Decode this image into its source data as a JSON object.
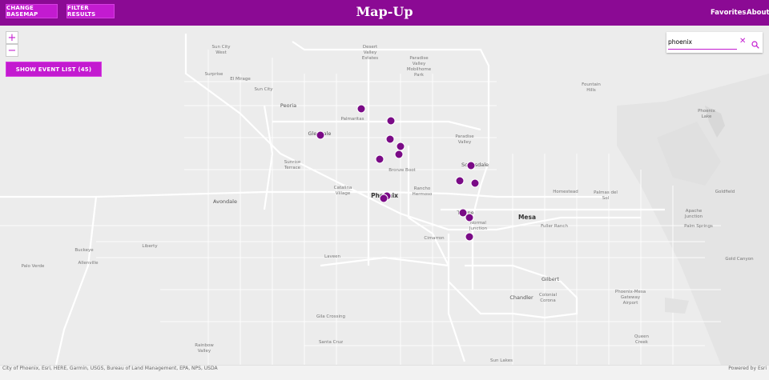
{
  "header": {
    "title": "Map-Up",
    "change_basemap": "CHANGE BASEMAP",
    "filter_results": "FILTER RESULTS",
    "favorites": "Favorites",
    "about": "About"
  },
  "map": {
    "show_event_list": "SHOW EVENT LIST (45)",
    "search_value": "phoenix",
    "zoom_in": "+",
    "zoom_out": "−",
    "labels": {
      "sun_city_west": "Sun City\nWest",
      "desert_valley": "Desert\nValley\nEstates",
      "paradise_mobile": "Paradise\nValley\nMobilhome\nPark",
      "surprise": "Surprise",
      "el_mirage": "El Mirage",
      "sun_city": "Sun City",
      "fountain_hills": "Fountain\nHills",
      "peoria": "Peoria",
      "palmaritas": "Palmaritas",
      "glendale": "Glendale",
      "paradise_valley": "Paradise\nValley",
      "sunrise_terrace": "Sunrise\nTerrace",
      "bronze_boot": "Bronze Boot",
      "scottsdale": "Scottsdale",
      "catalina": "Catalina\nVillage",
      "phoenix": "Phoenix",
      "rancho": "Rancho\nHermoso",
      "homestead": "Homestead",
      "palmas_del_sol": "Palmas del\nSol",
      "goldfield": "Goldfield",
      "avondale": "Avondale",
      "tempe": "Tempe",
      "mesa": "Mesa",
      "apache_junction": "Apache\nJunction",
      "normal_junction": "Normal\nJunction",
      "fuller_ranch": "Fuller Ranch",
      "palm_springs": "Palm Springs",
      "cimarron": "Cimarron",
      "buckeye": "Buckeye",
      "liberty": "Liberty",
      "palo_verde": "Palo Verde",
      "allenville": "Allenville",
      "laveen": "Laveen",
      "gold_canyon": "Gold Canyon",
      "gilbert": "Gilbert",
      "chandler": "Chandler",
      "colonial": "Colonial\nCorona",
      "phoenix_mesa": "Phoenix-Mesa\nGateway\nAirport",
      "gila_crossing": "Gila Crossing",
      "santa_cruz": "Santa Cruz",
      "rainbow_valley": "Rainbow\nValley",
      "queen_creek": "Queen\nCreek",
      "sun_lakes": "Sun Lakes",
      "phoenix_lake": "Phoenix\nLake"
    }
  },
  "footer": {
    "attribution": "City of Phoenix, Esri, HERE, Garmin, USGS, Bureau of Land Management, EPA, NPS, USDA",
    "powered": "Powered by Esri"
  },
  "colors": {
    "header": "#8b0a94",
    "button": "#c31bd0",
    "pin": "#7a0b86"
  }
}
